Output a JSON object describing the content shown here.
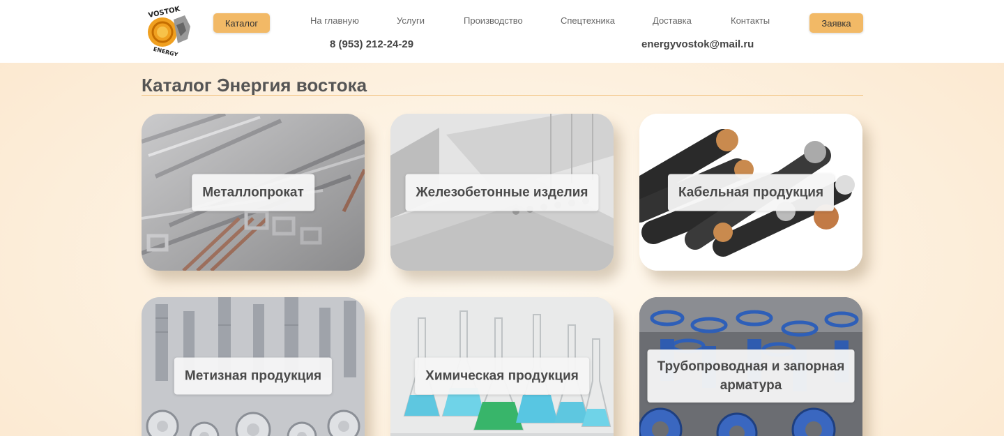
{
  "header": {
    "logo": {
      "icon": "vostok-energy-logo",
      "text_top": "VOSTOK",
      "text_bottom": "ENERGY"
    },
    "catalog_button": "Каталог",
    "nav": [
      "На главную",
      "Услуги",
      "Производство",
      "Спецтехника",
      "Доставка",
      "Контакты"
    ],
    "request_button": "Заявка",
    "phone": "8 (953) 212-24-29",
    "email": "energyvostok@mail.ru"
  },
  "main": {
    "title": "Каталог Энергия востока",
    "cards": [
      {
        "label": "Металлопрокат",
        "icon": "metal-rolling-photo"
      },
      {
        "label": "Железобетонные изделия",
        "icon": "concrete-slabs-photo"
      },
      {
        "label": "Кабельная продукция",
        "icon": "cables-photo"
      },
      {
        "label": "Метизная продукция",
        "icon": "bolts-nuts-photo"
      },
      {
        "label": "Химическая продукция",
        "icon": "lab-flasks-photo"
      },
      {
        "label": "Трубопроводная и запорная арматура",
        "icon": "pipeline-valves-photo"
      }
    ]
  },
  "colors": {
    "accent": "#f2b966",
    "background": "#fbe7cd",
    "rule": "#f1c07a"
  }
}
